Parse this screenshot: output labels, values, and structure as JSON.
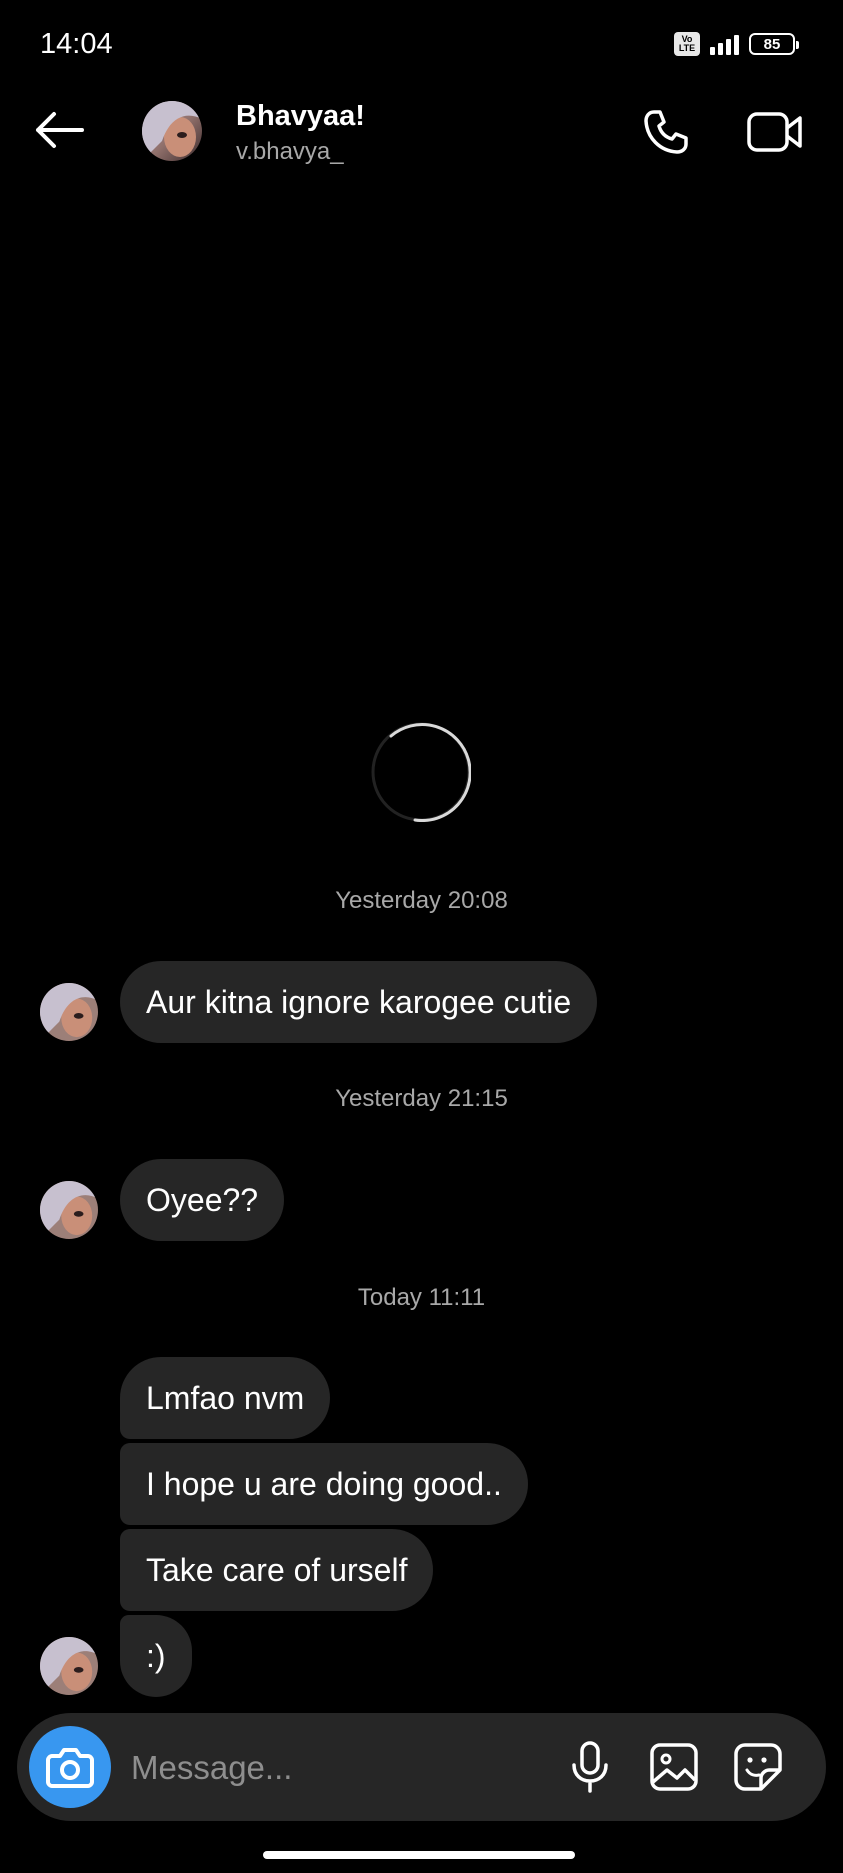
{
  "status_bar": {
    "time": "14:04",
    "network_badge": "Vo LTE",
    "signal_bars": 4,
    "battery_level": "85"
  },
  "header": {
    "contact_name": "Bhavyaa!",
    "contact_handle": "v.bhavya_",
    "icons": [
      "back-arrow-icon",
      "phone-icon",
      "video-camera-icon"
    ]
  },
  "conversation": {
    "loading": true,
    "sections": [
      {
        "timestamp": "Yesterday 20:08",
        "messages": [
          "Aur kitna ignore karogee cutie"
        ]
      },
      {
        "timestamp": "Yesterday 21:15",
        "messages": [
          "Oyee??"
        ]
      },
      {
        "timestamp": "Today 11:11",
        "messages": [
          "Lmfao nvm",
          "I hope u are doing good..",
          "Take care of urself",
          ":)"
        ]
      }
    ]
  },
  "composer": {
    "placeholder": "Message...",
    "icons": [
      "camera-icon",
      "microphone-icon",
      "gallery-icon",
      "sticker-icon"
    ]
  },
  "colors": {
    "background": "#000000",
    "bubble": "#262626",
    "accent": "#3897f0",
    "secondary_text": "#a8a8a8"
  }
}
